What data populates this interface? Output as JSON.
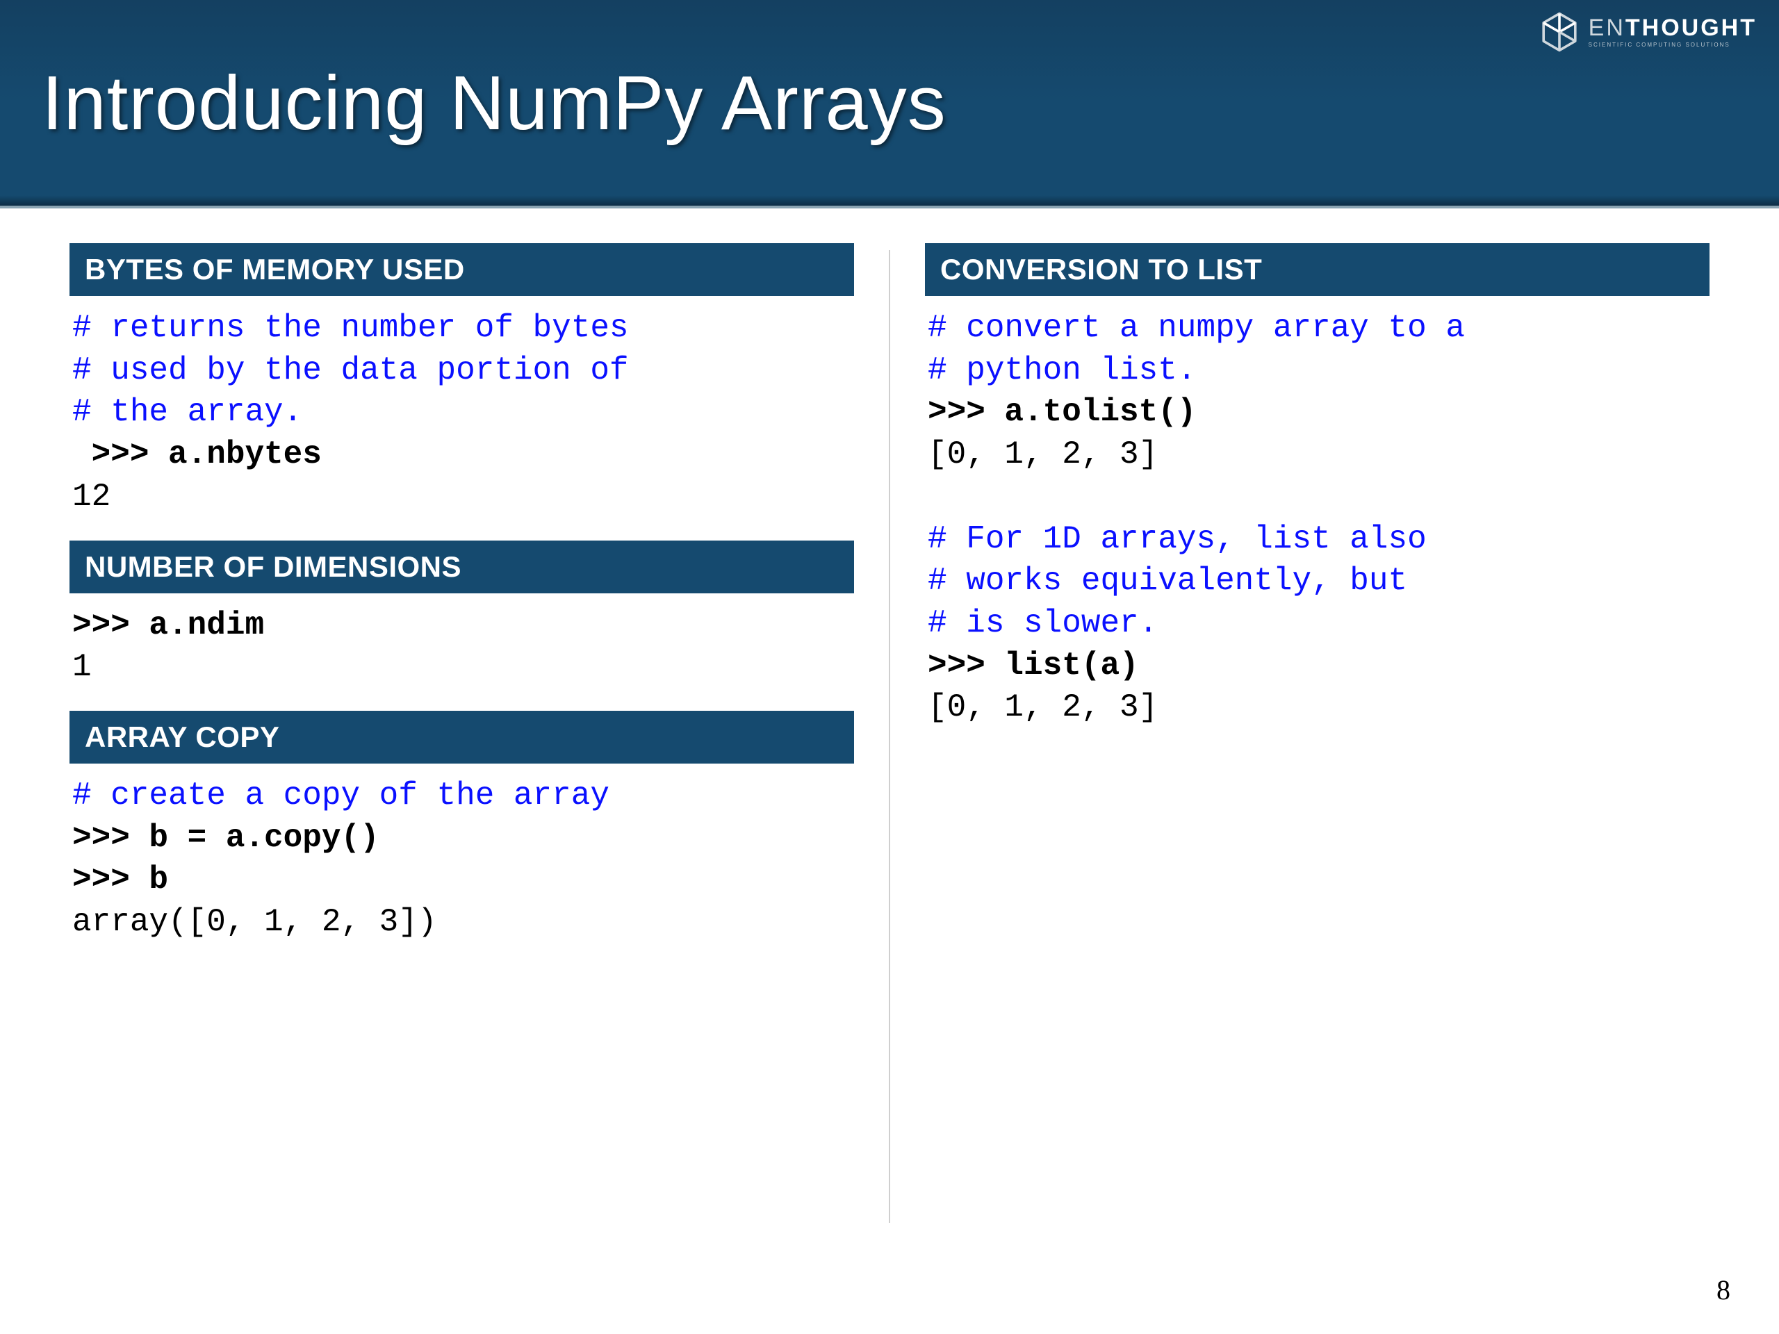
{
  "title": "Introducing NumPy Arrays",
  "brand": {
    "light": "EN",
    "bold": "THOUGHT",
    "tagline": "SCIENTIFIC COMPUTING SOLUTIONS"
  },
  "page_number": "8",
  "left": {
    "sec1": {
      "header": "BYTES OF MEMORY USED",
      "c1": "# returns the number of bytes",
      "c2": "# used by the data portion of",
      "c3": "# the array.",
      "prompt1": " >>> ",
      "cmd1": "a.nbytes",
      "out1": "12"
    },
    "sec2": {
      "header": "NUMBER OF DIMENSIONS",
      "prompt1": ">>> ",
      "cmd1": "a.ndim",
      "out1": "1"
    },
    "sec3": {
      "header": "ARRAY COPY",
      "c1": "# create a copy of the array",
      "prompt1": ">>> ",
      "cmd1": "b = a.copy()",
      "prompt2": ">>> ",
      "cmd2": "b",
      "out1": "array([0, 1, 2, 3])"
    }
  },
  "right": {
    "sec1": {
      "header": "CONVERSION TO LIST",
      "c1": "# convert a numpy array to a",
      "c2": "# python list.",
      "prompt1": ">>> ",
      "cmd1": "a.tolist()",
      "out1": "[0, 1, 2, 3]",
      "blank": "",
      "c3": "# For 1D arrays, list also",
      "c4": "# works equivalently, but",
      "c5": "# is slower.",
      "prompt2": ">>> ",
      "cmd2": "list(a)",
      "out2": "[0, 1, 2, 3]"
    }
  }
}
